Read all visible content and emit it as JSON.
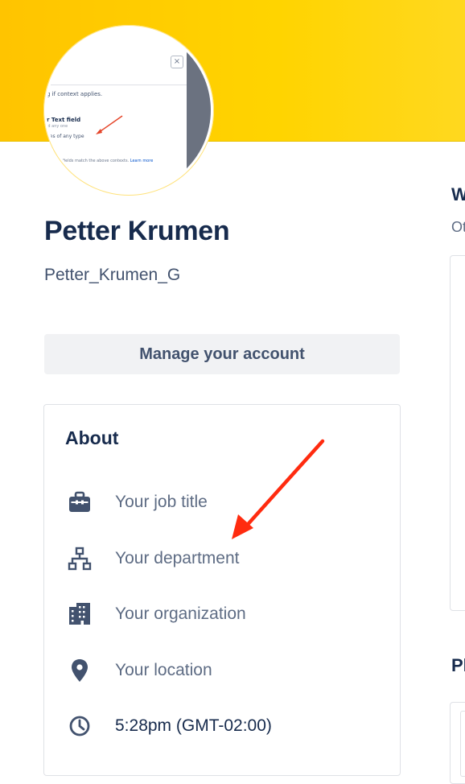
{
  "profile": {
    "name": "Petter Krumen",
    "username": "Petter_Krumen_G",
    "manage_label": "Manage your account"
  },
  "avatar_image": {
    "line1": "g if context applies.",
    "line2": "r Text field",
    "line3": "ld any one",
    "line4": "ues of any type",
    "footer_text": "fields match the above contexts.",
    "footer_link": "Learn more"
  },
  "about": {
    "title": "About",
    "items": [
      {
        "icon": "briefcase-icon",
        "label": "Your job title",
        "placeholder": true
      },
      {
        "icon": "department-icon",
        "label": "Your department",
        "placeholder": true
      },
      {
        "icon": "building-icon",
        "label": "Your organization",
        "placeholder": true
      },
      {
        "icon": "location-pin-icon",
        "label": "Your location",
        "placeholder": true
      },
      {
        "icon": "clock-icon",
        "label": "5:28pm (GMT-02:00)",
        "placeholder": false
      }
    ]
  },
  "right_column": {
    "heading": "W",
    "subtext": "Ot",
    "heading2": "Pl"
  },
  "colors": {
    "banner": "#ffc400",
    "title_text": "#172b4d",
    "placeholder_text": "#5e6c84",
    "icon": "#42526e",
    "annotation_arrow": "#ff2b0f"
  }
}
